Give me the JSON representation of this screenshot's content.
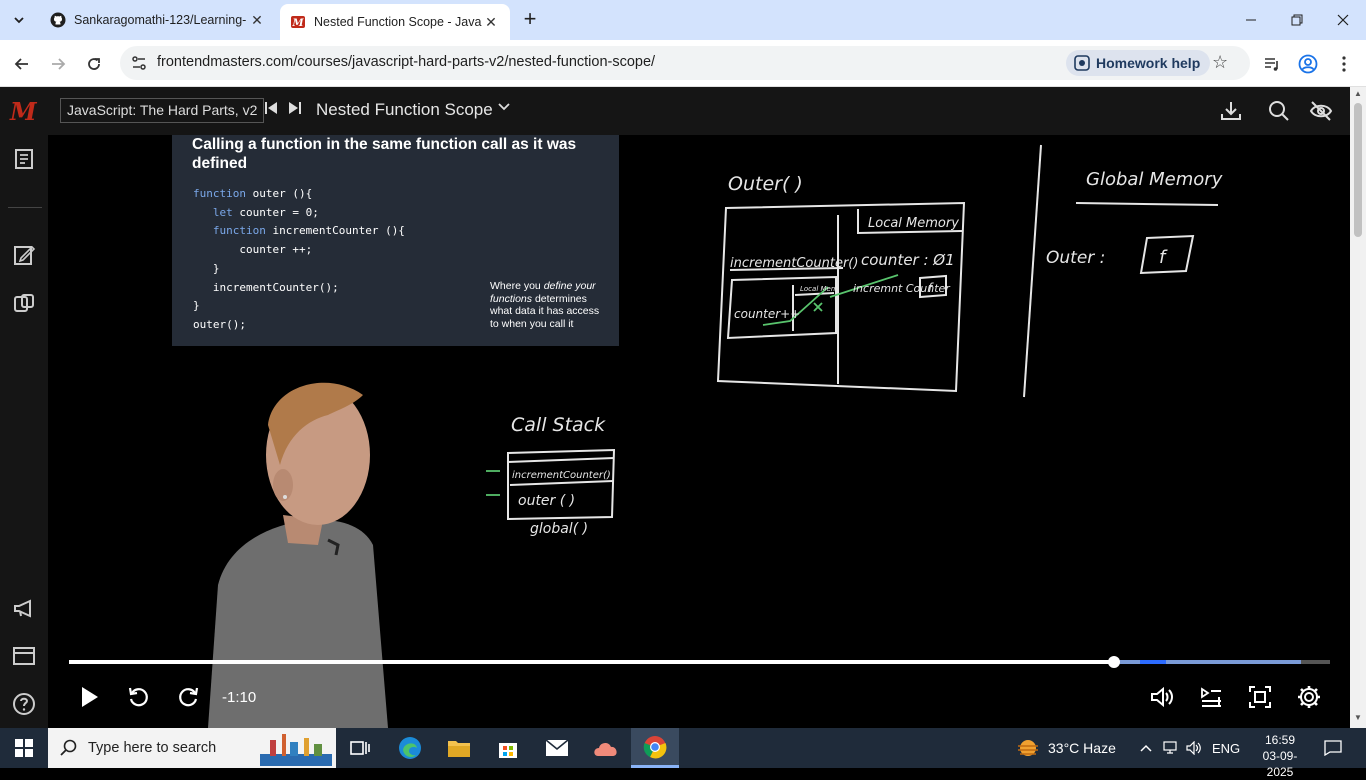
{
  "browser": {
    "tabs": [
      {
        "title": "Sankaragomathi-123/Learning-",
        "close": "✕"
      },
      {
        "title": "Nested Function Scope - JavaSc",
        "close": "✕"
      }
    ],
    "new_tab": "+",
    "url_host": "frontendmasters.com",
    "url_path": "/courses/javascript-hard-parts-v2/nested-function-scope/",
    "homework_help": "Homework help"
  },
  "site": {
    "logo": "M",
    "course": "JavaScript: The Hard Parts, v2",
    "lesson": "Nested Function Scope"
  },
  "slide": {
    "title": "Calling a function in the same function call as it was defined",
    "code": [
      {
        "kw": "function",
        "rest": " outer (){"
      },
      {
        "indent": "   ",
        "kw": "let",
        "rest": " counter = 0;"
      },
      {
        "indent": "   ",
        "kw": "function",
        "rest": " incrementCounter (){"
      },
      {
        "indent": "       ",
        "kw": "",
        "rest": "counter ++;"
      },
      {
        "indent": "   ",
        "kw": "",
        "rest": "}"
      },
      {
        "indent": "   ",
        "kw": "",
        "rest": "incrementCounter();"
      },
      {
        "indent": "",
        "kw": "",
        "rest": "}"
      },
      {
        "indent": "",
        "kw": "",
        "rest": "outer();"
      }
    ],
    "note_pre": "Where you ",
    "note_em": "define your functions",
    "note_post": " determines what data it has access to when you call it"
  },
  "whiteboard": {
    "outer_label": "Outer( )",
    "local_memory": "Local Memory",
    "increment_counter": "incrementCounter()",
    "counter_pp": "counter++",
    "local_mem_small": "Local Mem",
    "counter_value": "counter : Ø1",
    "increment_counter_entry": "incremnt Counter",
    "f_box": "f",
    "global_memory": "Global Memory",
    "outer_entry": "Outer :",
    "call_stack": "Call Stack",
    "stack": [
      "incrementCounter()",
      "outer ( )",
      "global( )"
    ]
  },
  "player": {
    "time_remaining": "-1:10",
    "progress_played": 0.829,
    "progress_buffered": 0.977
  },
  "taskbar": {
    "search_placeholder": "Type here to search",
    "weather": "33°C  Haze",
    "language": "ENG",
    "time": "16:59",
    "date": "03-09-2025"
  }
}
